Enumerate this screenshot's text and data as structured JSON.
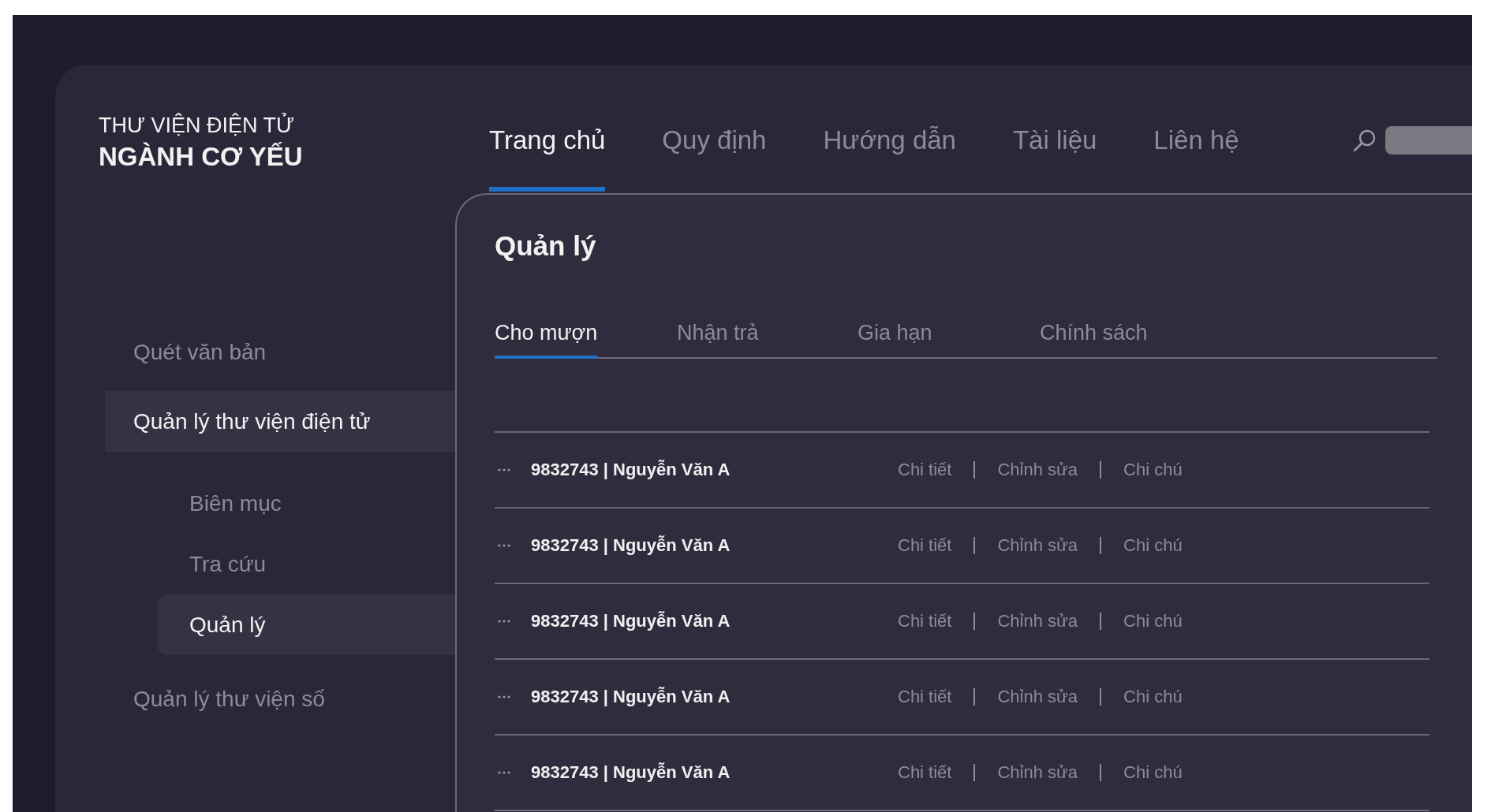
{
  "brand": {
    "line_1": "THƯ VIỆN ĐIỆN TỬ",
    "line_2": "NGÀNH CƠ YẾU"
  },
  "nav": [
    {
      "label": "Trang chủ",
      "selected": true
    },
    {
      "label": "Quy định",
      "selected": false
    },
    {
      "label": "Hướng dẫn",
      "selected": false
    },
    {
      "label": "Tài liệu",
      "selected": false
    },
    {
      "label": "Liên hệ",
      "selected": false
    }
  ],
  "sidebar": {
    "items": [
      {
        "label": "Quét văn bản",
        "selected": false
      },
      {
        "label": "Quản lý thư viện điện tử",
        "selected": true,
        "children": [
          {
            "label": "Biên mục",
            "selected": false
          },
          {
            "label": "Tra cứu",
            "selected": false
          },
          {
            "label": "Quản lý",
            "selected": true
          }
        ]
      },
      {
        "label": "Quản lý thư viện số",
        "selected": false
      }
    ]
  },
  "panel": {
    "title": "Quản lý",
    "tabs": [
      {
        "label": "Cho mượn",
        "selected": true
      },
      {
        "label": "Nhận trả",
        "selected": false
      },
      {
        "label": "Gia hạn",
        "selected": false
      },
      {
        "label": "Chính sách",
        "selected": false
      }
    ],
    "rows": [
      {
        "title": "9832743 | Nguyễn Văn A",
        "actions": [
          "Chi tiết",
          "Chỉnh sửa",
          "Chi chú"
        ]
      },
      {
        "title": "9832743 | Nguyễn Văn A",
        "actions": [
          "Chi tiết",
          "Chỉnh sửa",
          "Chi chú"
        ]
      },
      {
        "title": "9832743 | Nguyễn Văn A",
        "actions": [
          "Chi tiết",
          "Chỉnh sửa",
          "Chi chú"
        ]
      },
      {
        "title": "9832743 | Nguyễn Văn A",
        "actions": [
          "Chi tiết",
          "Chỉnh sửa",
          "Chi chú"
        ]
      },
      {
        "title": "9832743 | Nguyễn Văn A",
        "actions": [
          "Chi tiết",
          "Chỉnh sửa",
          "Chi chú"
        ]
      }
    ]
  }
}
